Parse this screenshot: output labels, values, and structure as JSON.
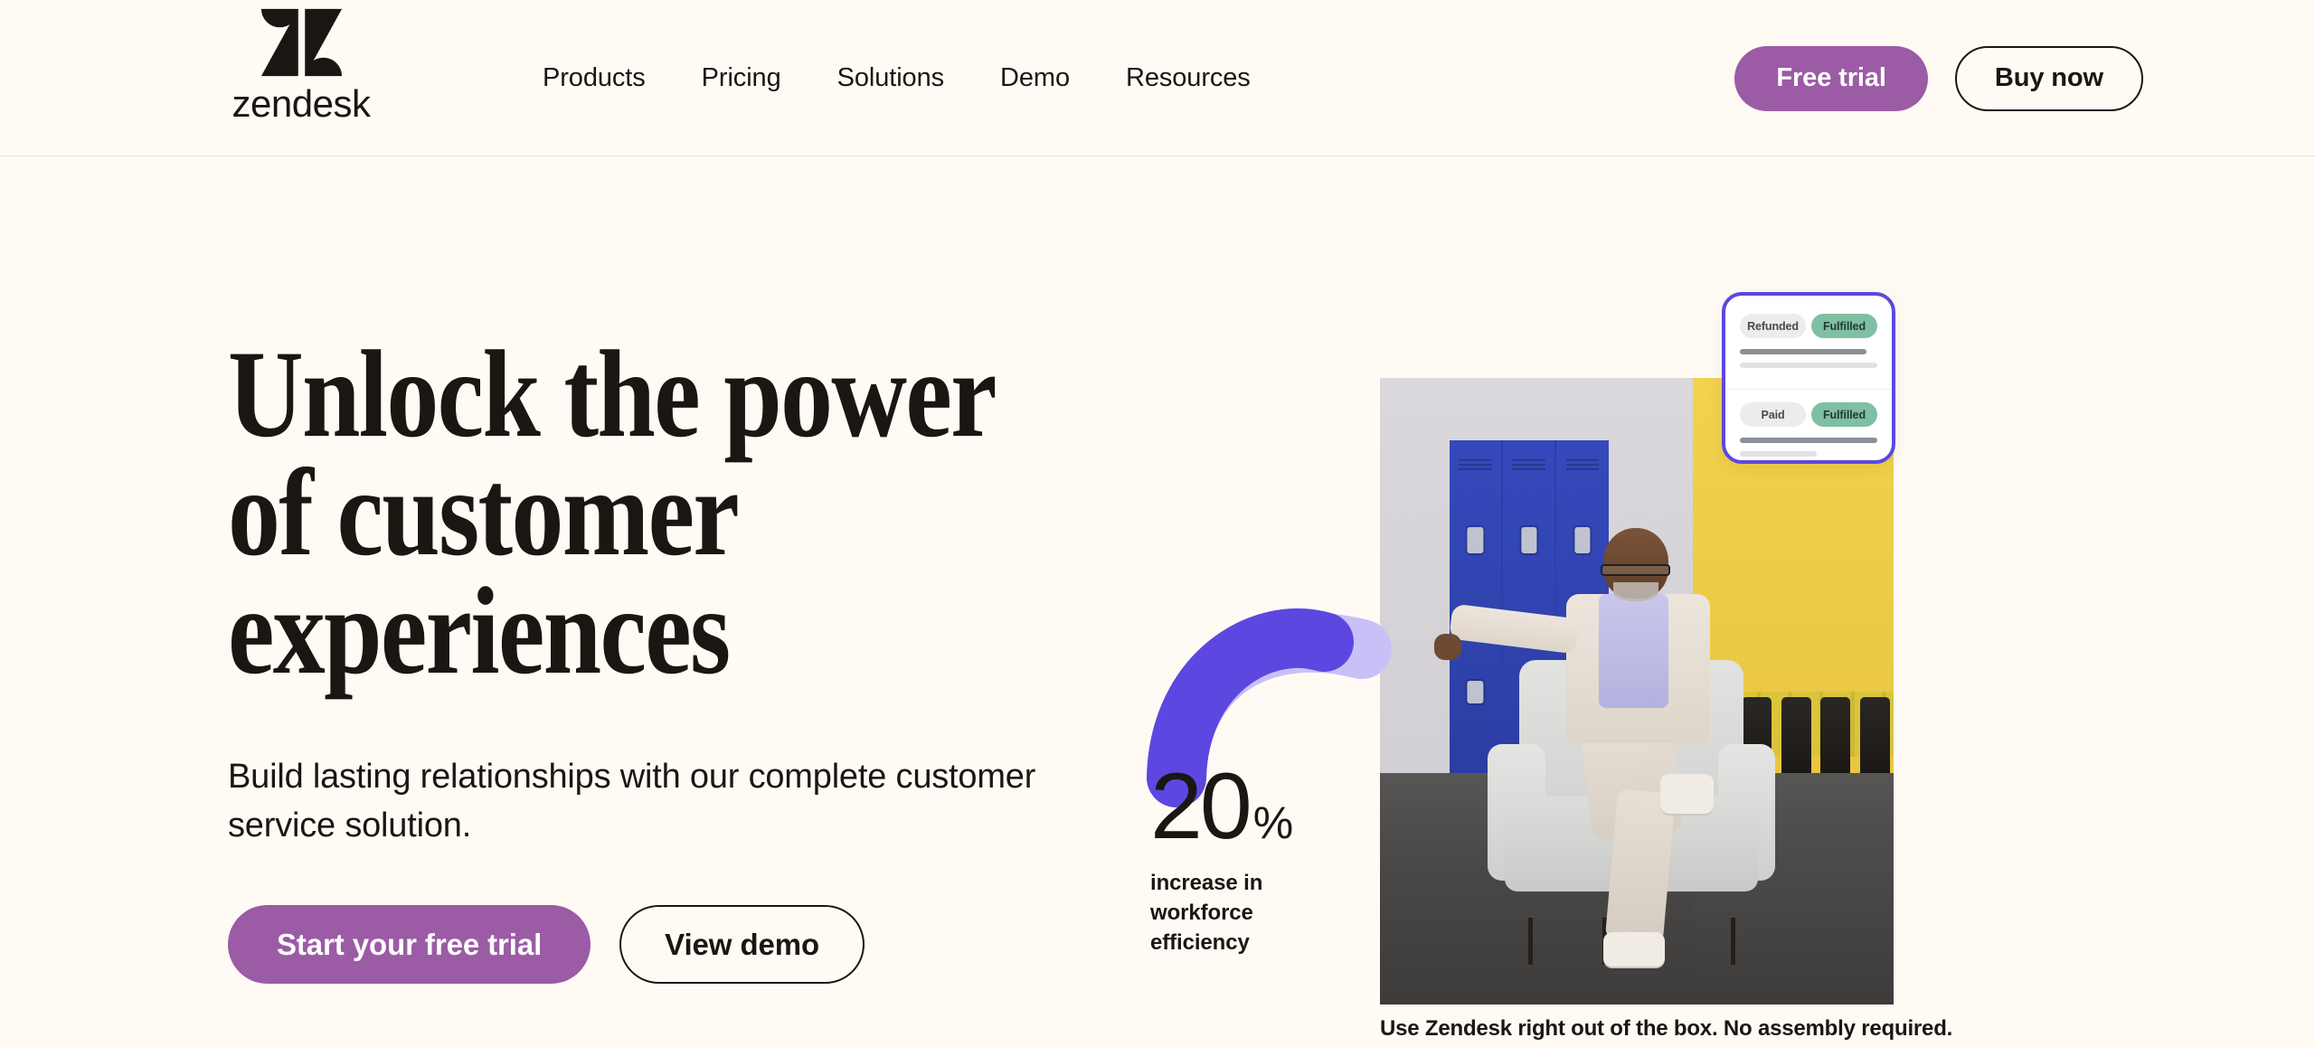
{
  "brand": {
    "name": "zendesk",
    "logo_icon": "zendesk-z-logo",
    "accent_purple": "#9B5BA5",
    "arc_purple": "#5C48E0",
    "arc_purple_light": "#C9C0F7",
    "background": "#FFFBF4",
    "text": "#1A1713"
  },
  "header": {
    "nav": [
      {
        "label": "Products"
      },
      {
        "label": "Pricing"
      },
      {
        "label": "Solutions"
      },
      {
        "label": "Demo"
      },
      {
        "label": "Resources"
      }
    ],
    "free_trial_label": "Free trial",
    "buy_now_label": "Buy now"
  },
  "hero": {
    "title_line_1": "Unlock the power",
    "title_line_2": "of customer",
    "title_line_3": "experiences",
    "subtitle": "Build lasting relationships with our complete customer service solution.",
    "primary_cta": "Start your free trial",
    "secondary_cta": "View demo",
    "caption": "Use Zendesk right out of the box. No assembly required."
  },
  "stat": {
    "value": "20",
    "unit": "%",
    "label": "increase in workforce efficiency"
  },
  "status_card": {
    "rows": [
      {
        "status_badge": "Refunded",
        "fulfillment_badge": "Fulfilled"
      },
      {
        "status_badge": "Paid",
        "fulfillment_badge": "Fulfilled"
      }
    ]
  }
}
